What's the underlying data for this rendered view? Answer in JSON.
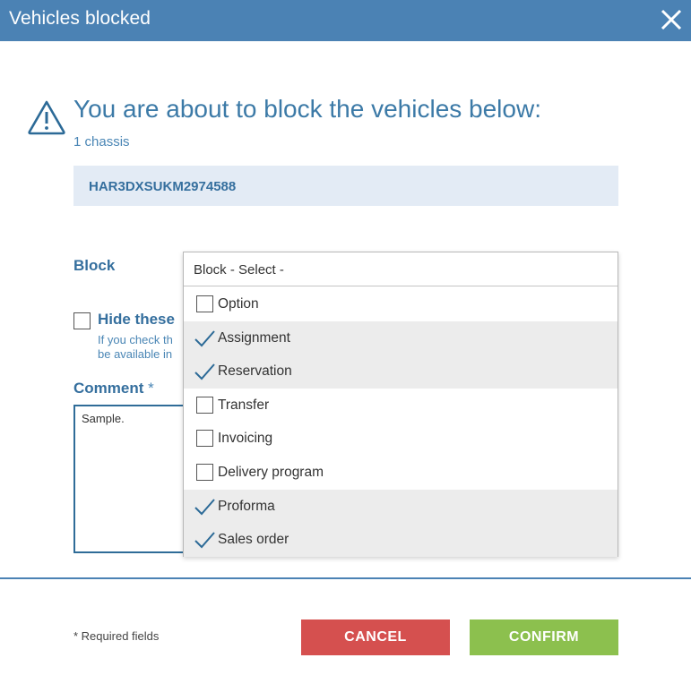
{
  "dialog": {
    "title": "Vehicles blocked",
    "heading": "You are about to block the vehicles below:",
    "chassis_count": "1 chassis",
    "chassis_ids": [
      "HAR3DXSUKM2974588"
    ]
  },
  "block": {
    "label": "Block",
    "select_text": "Block - Select -",
    "options": [
      {
        "label": "Option",
        "checked": false
      },
      {
        "label": "Assignment",
        "checked": true
      },
      {
        "label": "Reservation",
        "checked": true
      },
      {
        "label": "Transfer",
        "checked": false
      },
      {
        "label": "Invoicing",
        "checked": false
      },
      {
        "label": "Delivery program",
        "checked": false
      },
      {
        "label": "Proforma",
        "checked": true
      },
      {
        "label": "Sales order",
        "checked": true
      }
    ]
  },
  "hide": {
    "label": "Hide these",
    "help_line1": "If you check th",
    "help_line2": "be available in",
    "checked": false
  },
  "comment": {
    "label": "Comment",
    "required_mark": "*",
    "value": "Sample."
  },
  "footer": {
    "required_note": "* Required fields",
    "cancel_label": "CANCEL",
    "confirm_label": "CONFIRM"
  },
  "colors": {
    "title_bar": "#4b82b4",
    "accent_text": "#356f9e",
    "cancel": "#d5504f",
    "confirm": "#8cc04e",
    "chassis_bg": "#e3ebf5"
  },
  "icons": {
    "close": "close-icon",
    "warning": "warning-icon",
    "check": "checkmark-icon"
  }
}
